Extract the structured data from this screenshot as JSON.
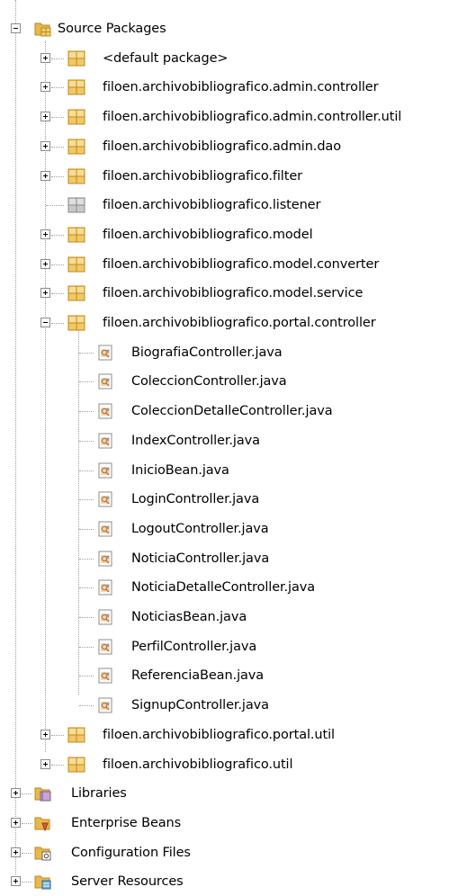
{
  "tree": {
    "source_packages": "Source Packages",
    "packages": [
      {
        "label": "<default package>",
        "state": "collapsed"
      },
      {
        "label": "filoen.archivobibliografico.admin.controller",
        "state": "collapsed"
      },
      {
        "label": "filoen.archivobibliografico.admin.controller.util",
        "state": "collapsed"
      },
      {
        "label": "filoen.archivobibliografico.admin.dao",
        "state": "collapsed"
      },
      {
        "label": "filoen.archivobibliografico.filter",
        "state": "collapsed"
      },
      {
        "label": "filoen.archivobibliografico.listener",
        "state": "empty"
      },
      {
        "label": "filoen.archivobibliografico.model",
        "state": "collapsed"
      },
      {
        "label": "filoen.archivobibliografico.model.converter",
        "state": "collapsed"
      },
      {
        "label": "filoen.archivobibliografico.model.service",
        "state": "collapsed"
      },
      {
        "label": "filoen.archivobibliografico.portal.controller",
        "state": "expanded"
      }
    ],
    "files": [
      "BiografiaController.java",
      "ColeccionController.java",
      "ColeccionDetalleController.java",
      "IndexController.java",
      "InicioBean.java",
      "LoginController.java",
      "LogoutController.java",
      "NoticiaController.java",
      "NoticiaDetalleController.java",
      "NoticiasBean.java",
      "PerfilController.java",
      "ReferenciaBean.java",
      "SignupController.java"
    ],
    "packages_after": [
      {
        "label": "filoen.archivobibliografico.portal.util",
        "state": "collapsed"
      },
      {
        "label": "filoen.archivobibliografico.util",
        "state": "collapsed"
      }
    ],
    "roots": [
      {
        "label": "Libraries",
        "icon": "libraries-icon"
      },
      {
        "label": "Enterprise Beans",
        "icon": "enterprise-beans-icon"
      },
      {
        "label": "Configuration Files",
        "icon": "configuration-files-icon"
      },
      {
        "label": "Server Resources",
        "icon": "server-resources-icon"
      }
    ]
  }
}
